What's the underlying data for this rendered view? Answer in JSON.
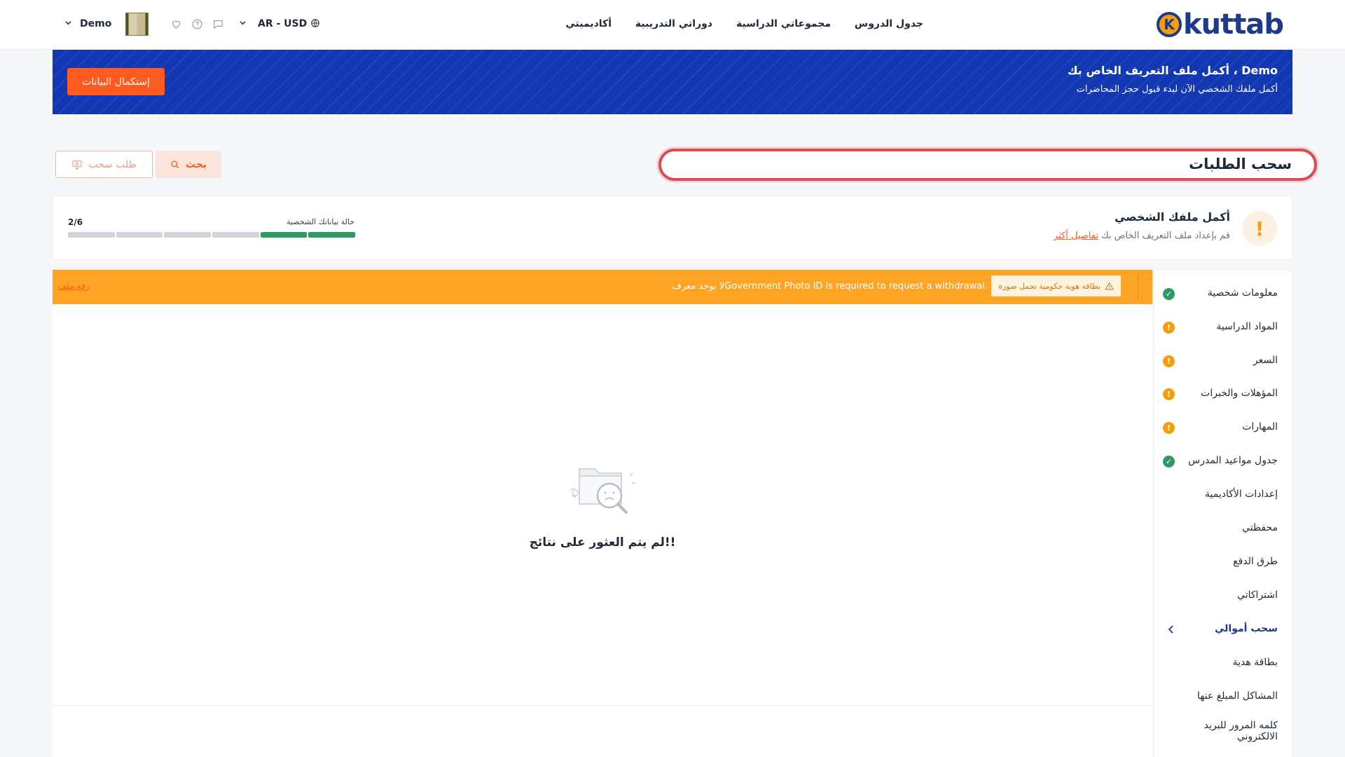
{
  "header": {
    "logo_text": "kuttab",
    "logo_letter": "K",
    "nav": [
      "جدول الدروس",
      "مجموعاتي الدراسية",
      "دوراتي التدريبية",
      "أكاديميتي"
    ],
    "language": "AR - USD",
    "user_name": "Demo"
  },
  "banner": {
    "title": "أكمل ملف التعريف الخاص بك ، Demo",
    "subtitle": "أكمل ملفك الشخصي الآن لبدء قبول حجز المحاضرات",
    "button_label": "إستكمال البيانات",
    "bg_color": "#1237b3",
    "button_color": "#ff5a1f"
  },
  "page": {
    "title": "سحب الطلبات",
    "search_label": "بحث",
    "withdraw_request_label": "طلب سحب"
  },
  "profile_card": {
    "title": "أكمل ملفك الشخصي",
    "subtitle": "قم بإعداد ملف التعريف الخاص بك",
    "details_link": "تفاصيل أكثر",
    "status_label": "حالة بياناتك الشخصية",
    "count_text": "2/6",
    "completed": 2,
    "total": 6
  },
  "sidebar": {
    "items": [
      {
        "label": "معلومات شخصية",
        "status": "ok"
      },
      {
        "label": "المواد الدراسية",
        "status": "warn"
      },
      {
        "label": "السعر",
        "status": "warn"
      },
      {
        "label": "المؤهلات والخبرات",
        "status": "warn"
      },
      {
        "label": "المهارات",
        "status": "warn"
      },
      {
        "label": "جدول مواعيد المدرس",
        "status": "ok"
      },
      {
        "label": "إعدادات الأكاديمية",
        "status": "none"
      },
      {
        "label": "محفظتي",
        "status": "none"
      },
      {
        "label": "طرق الدفع",
        "status": "none"
      },
      {
        "label": "اشتراكاتي",
        "status": "none"
      },
      {
        "label": "سحب أموالي",
        "status": "active"
      },
      {
        "label": "بطاقة هدية",
        "status": "none"
      },
      {
        "label": "المشاكل المبلغ عنها",
        "status": "none"
      },
      {
        "label": "كلمه المرور للبريد الالكتروني",
        "status": "none"
      }
    ]
  },
  "alert": {
    "chip_text": "بطاقة هوية حكومية تحمل صورة",
    "message": "لا يوجد معرفGovernment Photo ID is required to request a withdrawal.",
    "upload_link": "رفع ملف",
    "bg_color": "#fea424"
  },
  "empty_state": {
    "message": "لم يتم العثور على نتائج!!"
  }
}
